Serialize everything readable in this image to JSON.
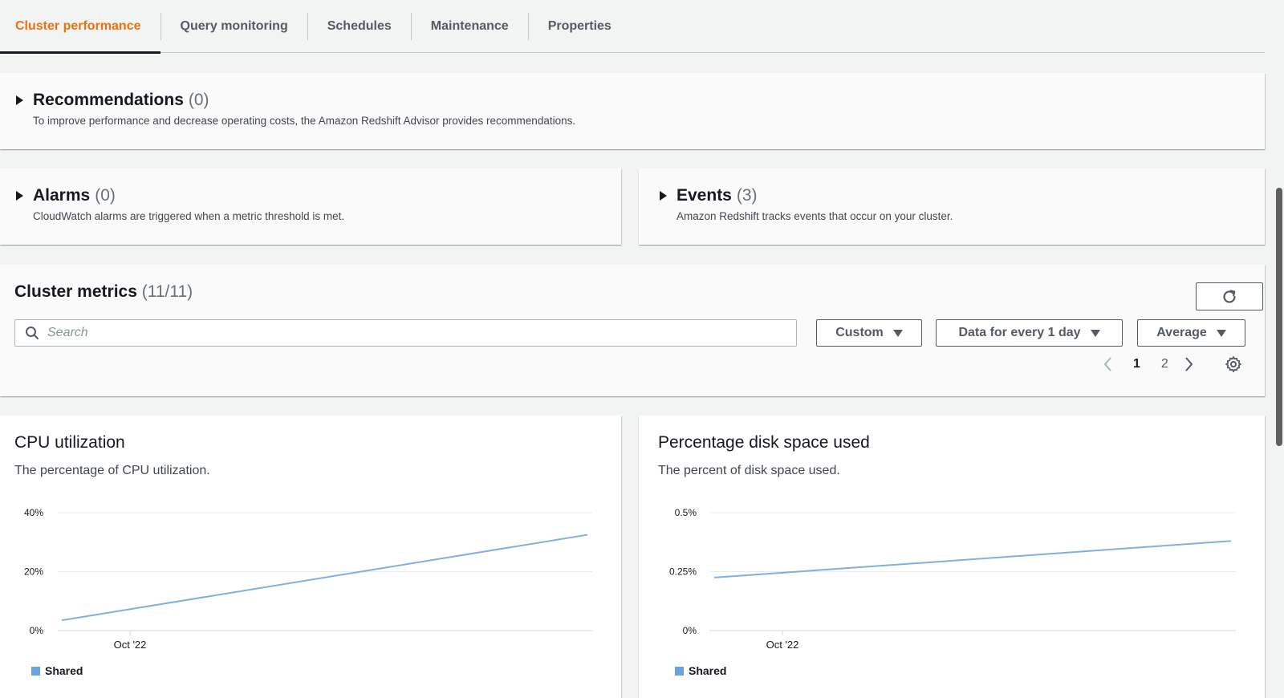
{
  "tabs": [
    {
      "label": "Cluster performance",
      "active": true
    },
    {
      "label": "Query monitoring"
    },
    {
      "label": "Schedules"
    },
    {
      "label": "Maintenance"
    },
    {
      "label": "Properties"
    }
  ],
  "recommendations": {
    "title": "Recommendations",
    "count": "(0)",
    "description": "To improve performance and decrease operating costs, the Amazon Redshift Advisor provides recommendations."
  },
  "alarms": {
    "title": "Alarms",
    "count": "(0)",
    "description": "CloudWatch alarms are triggered when a metric threshold is met."
  },
  "events": {
    "title": "Events",
    "count": "(3)",
    "description": "Amazon Redshift tracks events that occur on your cluster."
  },
  "cluster_metrics": {
    "title": "Cluster metrics",
    "count": "(11/11)",
    "search_placeholder": "Search",
    "range_select": "Custom",
    "period_select": "Data for every 1 day",
    "stat_select": "Average",
    "pages": [
      "1",
      "2"
    ],
    "current_page": "1"
  },
  "charts": {
    "cpu": {
      "title": "CPU utilization",
      "description": "The percentage of CPU utilization."
    },
    "disk": {
      "title": "Percentage disk space used",
      "description": "The percent of disk space used."
    }
  },
  "colors": {
    "accent": "#ec7211",
    "series": "#7fb0e0",
    "legend": "#6aa4e0"
  },
  "chart_data": [
    {
      "type": "line",
      "title": "CPU utilization",
      "x_tick_labels": [
        "Oct '22"
      ],
      "y_tick_labels": [
        "40%",
        "20%",
        "0%"
      ],
      "ylim": [
        0,
        40
      ],
      "grid": true,
      "legend_position": "bottom-left",
      "series": [
        {
          "name": "Shared",
          "x": [
            "start",
            "end"
          ],
          "values": [
            3.5,
            32.5
          ]
        }
      ]
    },
    {
      "type": "line",
      "title": "Percentage disk space used",
      "x_tick_labels": [
        "Oct '22"
      ],
      "y_tick_labels": [
        "0.5%",
        "0.25%",
        "0%"
      ],
      "ylim": [
        0,
        0.5
      ],
      "grid": true,
      "legend_position": "bottom-left",
      "series": [
        {
          "name": "Shared",
          "x": [
            "start",
            "end"
          ],
          "values": [
            0.225,
            0.38
          ]
        }
      ]
    }
  ]
}
